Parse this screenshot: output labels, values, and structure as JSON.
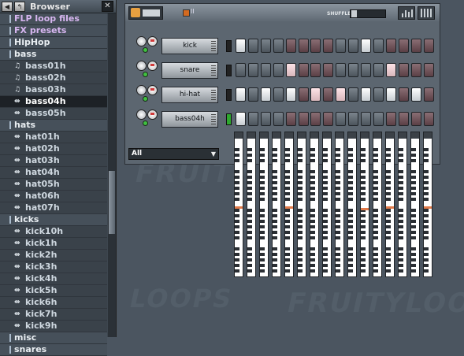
{
  "browser": {
    "title": "Browser",
    "close_label": "✕",
    "items": [
      {
        "label": "FLP loop files",
        "kind": "folder",
        "style": "purple"
      },
      {
        "label": "FX presets",
        "kind": "folder",
        "style": "purple"
      },
      {
        "label": "HipHop",
        "kind": "folder",
        "style": "bold"
      },
      {
        "label": "bass",
        "kind": "folder",
        "style": "bold"
      },
      {
        "label": "bass01h",
        "kind": "file"
      },
      {
        "label": "bass02h",
        "kind": "file"
      },
      {
        "label": "bass03h",
        "kind": "file"
      },
      {
        "label": "bass04h",
        "kind": "file",
        "selected": true
      },
      {
        "label": "bass05h",
        "kind": "file"
      },
      {
        "label": "hats",
        "kind": "folder",
        "style": "bold"
      },
      {
        "label": "hat01h",
        "kind": "file"
      },
      {
        "label": "hat02h",
        "kind": "file"
      },
      {
        "label": "hat03h",
        "kind": "file"
      },
      {
        "label": "hat04h",
        "kind": "file"
      },
      {
        "label": "hat05h",
        "kind": "file"
      },
      {
        "label": "hat06h",
        "kind": "file"
      },
      {
        "label": "hat07h",
        "kind": "file"
      },
      {
        "label": "kicks",
        "kind": "folder",
        "style": "bold"
      },
      {
        "label": "kick10h",
        "kind": "file"
      },
      {
        "label": "kick1h",
        "kind": "file"
      },
      {
        "label": "kick2h",
        "kind": "file"
      },
      {
        "label": "kick3h",
        "kind": "file"
      },
      {
        "label": "kick4h",
        "kind": "file"
      },
      {
        "label": "kick5h",
        "kind": "file"
      },
      {
        "label": "kick6h",
        "kind": "file"
      },
      {
        "label": "kick7h",
        "kind": "file"
      },
      {
        "label": "kick9h",
        "kind": "file"
      },
      {
        "label": "misc",
        "kind": "folder",
        "style": "bold"
      },
      {
        "label": "snares",
        "kind": "folder",
        "style": "bold"
      }
    ]
  },
  "sequencer": {
    "indicator_label": "II",
    "shuffle_label": "SHUFFLE",
    "filter_value": "All",
    "channels": [
      {
        "name": "kick",
        "active": false,
        "steps": [
          1,
          0,
          0,
          0,
          0,
          0,
          0,
          0,
          0,
          0,
          1,
          0,
          0,
          0,
          0,
          0
        ]
      },
      {
        "name": "snare",
        "active": false,
        "steps": [
          0,
          0,
          0,
          0,
          2,
          0,
          0,
          0,
          0,
          0,
          0,
          0,
          2,
          0,
          0,
          0
        ]
      },
      {
        "name": "hi-hat",
        "active": false,
        "steps": [
          1,
          0,
          1,
          0,
          1,
          0,
          2,
          0,
          2,
          0,
          1,
          0,
          1,
          0,
          1,
          0
        ]
      },
      {
        "name": "bass04h",
        "active": true,
        "steps": [
          1,
          0,
          0,
          0,
          0,
          0,
          0,
          0,
          0,
          0,
          0,
          0,
          0,
          0,
          0,
          0
        ]
      }
    ]
  },
  "watermark": {
    "line1": "FRUITY",
    "line2": "FRUITYLOOPS",
    "line3": "LOOPS"
  },
  "colors": {
    "accent": "#e27b4a",
    "active_led": "#2ea82e"
  },
  "icons": [
    "fruity-logo-icon",
    "back-arrow-icon",
    "up-arrow-icon",
    "close-icon",
    "dropdown-arrow-icon",
    "audio-file-icon"
  ]
}
